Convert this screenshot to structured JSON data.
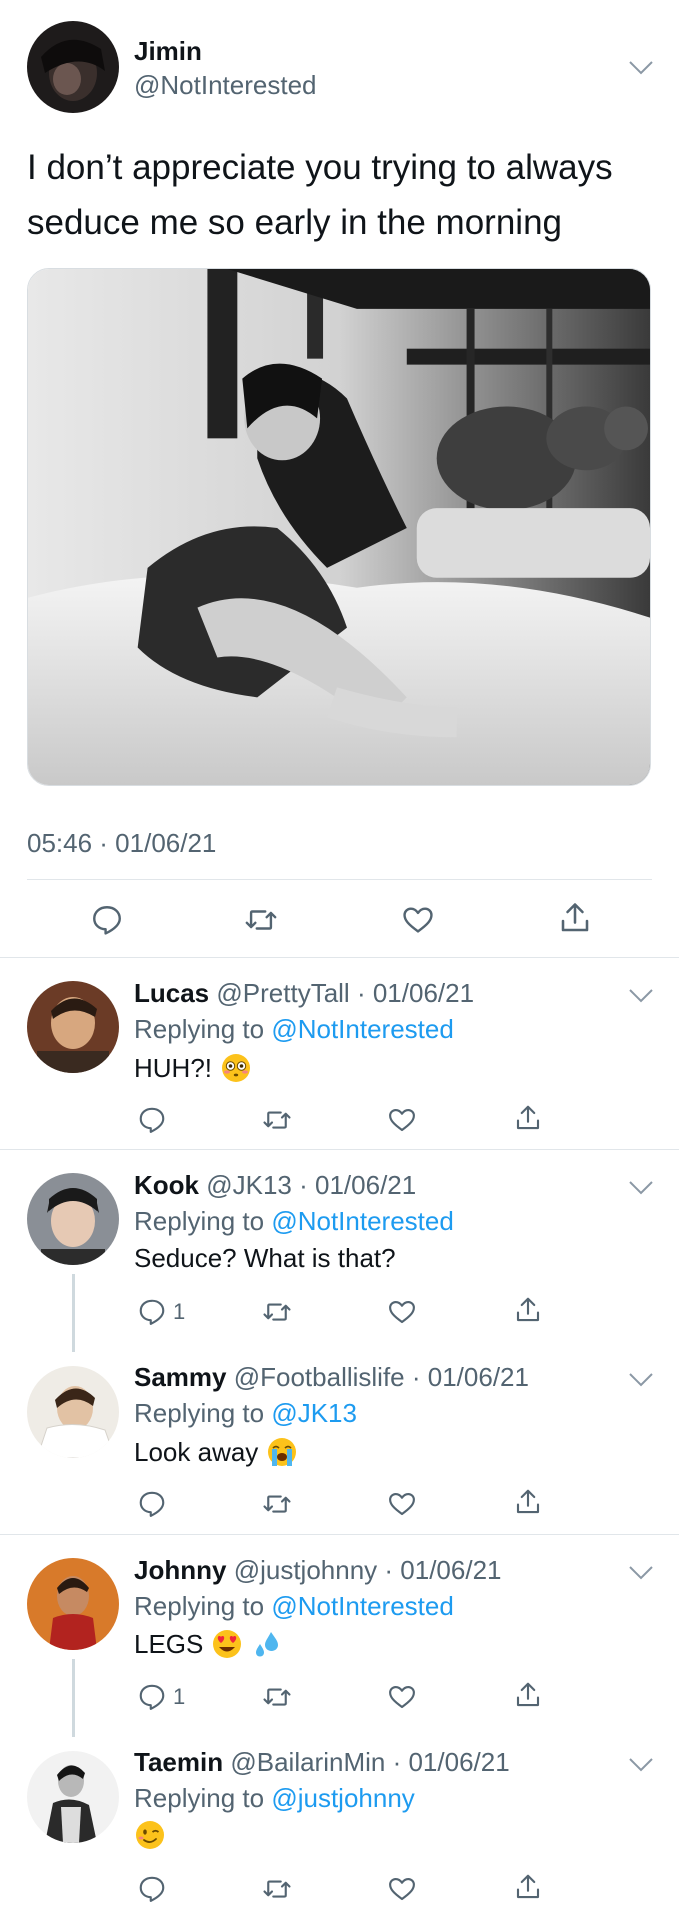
{
  "main_tweet": {
    "name": "Jimin",
    "handle": "@NotInterested",
    "text": "I don’t appreciate you trying to always seduce me so early in the morning",
    "timestamp": "05:46 · 01/06/21",
    "actions": [
      "reply-icon",
      "retweet-icon",
      "like-icon",
      "share-icon"
    ]
  },
  "replies": [
    {
      "name": "Lucas",
      "handle": "@PrettyTall",
      "time": "· 01/06/21",
      "replying_prefix": "Replying to",
      "replying_to": "@NotInterested",
      "text": "HUH?!",
      "emoji": "flushed-face",
      "reply_count": ""
    },
    {
      "name": "Kook",
      "handle": "@JK13",
      "time": "· 01/06/21",
      "replying_prefix": "Replying to",
      "replying_to": "@NotInterested",
      "text": "Seduce? What is that?",
      "reply_count": "1"
    },
    {
      "name": "Sammy",
      "handle": "@Footballislife",
      "time": "· 01/06/21",
      "replying_prefix": "Replying to",
      "replying_to": "@JK13",
      "text": "Look away",
      "emoji": "loudly-crying-face",
      "reply_count": ""
    },
    {
      "name": "Johnny",
      "handle": "@justjohnny",
      "time": "· 01/06/21",
      "replying_prefix": "Replying to",
      "replying_to": "@NotInterested",
      "text": "LEGS",
      "emoji": "heart-eyes-face, sweat-droplets",
      "reply_count": "1"
    },
    {
      "name": "Taemin",
      "handle": "@BailarinMin",
      "time": "· 01/06/21",
      "replying_prefix": "Replying to",
      "replying_to": "@justjohnny",
      "text": "",
      "emoji": "winking-face",
      "reply_count": ""
    }
  ],
  "colors": {
    "accent": "#1d9bf0",
    "secondary_text": "#536471",
    "divider": "#e1e6ea"
  }
}
